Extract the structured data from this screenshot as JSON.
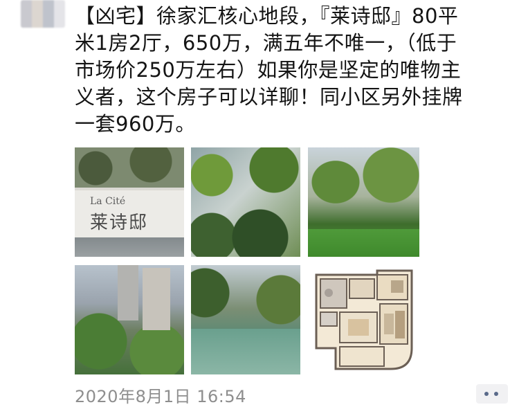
{
  "post": {
    "lines": [
      "【凶宅】徐家汇核心地段，『莱诗邸』80平",
      "米1房2厅，650万，满五年不唯一，（低于",
      "市场价250万左右）如果你是坚定的唯物主",
      "义者，这个房子可以详聊！同小区另外挂牌",
      "一套960万。"
    ]
  },
  "photos": {
    "sign_latin": "La Cité",
    "sign_chinese": "莱诗邸"
  },
  "timestamp": "2020年8月1日 16:54"
}
